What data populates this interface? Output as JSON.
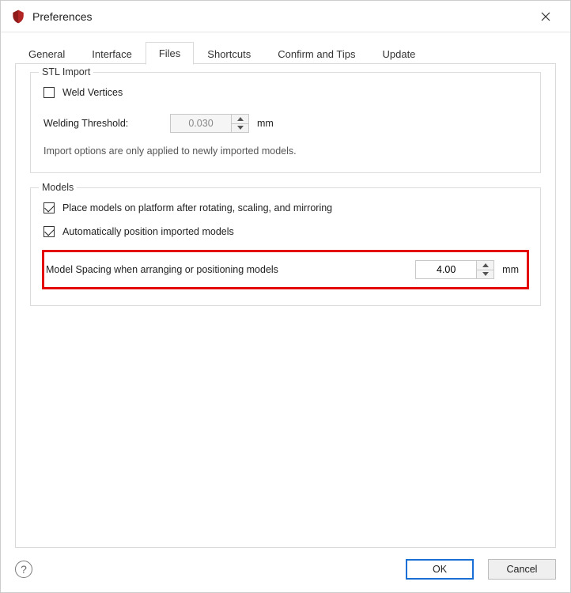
{
  "window": {
    "title": "Preferences"
  },
  "tabs": {
    "general": "General",
    "interface": "Interface",
    "files": "Files",
    "shortcuts": "Shortcuts",
    "confirm": "Confirm and Tips",
    "update": "Update"
  },
  "active_tab": "files",
  "stl": {
    "group_title": "STL Import",
    "weld_vertices": {
      "label": "Weld Vertices",
      "checked": false
    },
    "threshold": {
      "label": "Welding Threshold:",
      "value": "0.030",
      "unit": "mm",
      "enabled": false
    },
    "hint": "Import options are only applied to newly imported models."
  },
  "models": {
    "group_title": "Models",
    "place_on_platform": {
      "label": "Place models on platform after rotating, scaling, and mirroring",
      "checked": true
    },
    "auto_position": {
      "label": "Automatically position imported models",
      "checked": true
    },
    "model_spacing": {
      "label": "Model Spacing when arranging or positioning models",
      "value": "4.00",
      "unit": "mm"
    }
  },
  "footer": {
    "ok": "OK",
    "cancel": "Cancel"
  }
}
